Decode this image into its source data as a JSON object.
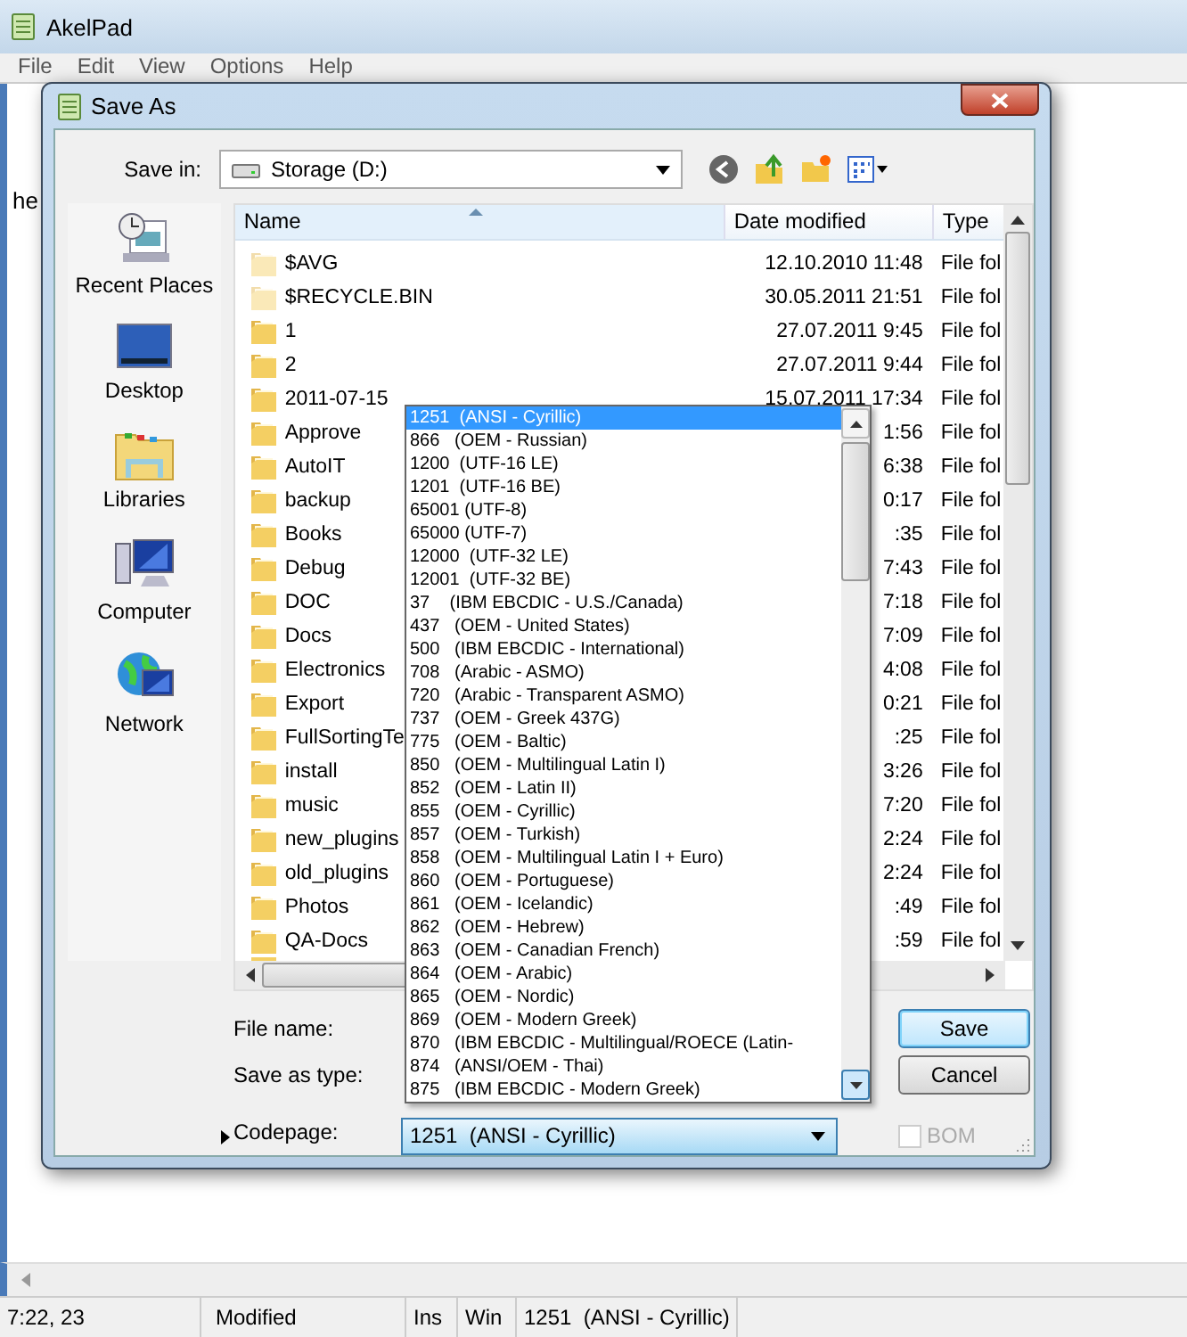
{
  "app_window": {
    "title": "AkelPad",
    "menu": [
      "File",
      "Edit",
      "View",
      "Options",
      "Help"
    ],
    "editor_text": "he"
  },
  "dialog": {
    "title": "Save As",
    "save_in": {
      "label": "Save in:",
      "value": "Storage (D:)"
    },
    "places": [
      "Recent Places",
      "Desktop",
      "Libraries",
      "Computer",
      "Network"
    ],
    "file_list": {
      "columns": [
        "Name",
        "Date modified",
        "Type"
      ],
      "rows": [
        {
          "name": "$AVG",
          "date": "12.10.2010 11:48",
          "type": "File fol",
          "hidden": true
        },
        {
          "name": "$RECYCLE.BIN",
          "date": "30.05.2011 21:51",
          "type": "File fol",
          "hidden": true
        },
        {
          "name": "1",
          "date": "27.07.2011 9:45",
          "type": "File fol",
          "hidden": false
        },
        {
          "name": "2",
          "date": "27.07.2011 9:44",
          "type": "File fol",
          "hidden": false
        },
        {
          "name": "2011-07-15",
          "date": "15.07.2011 17:34",
          "type": "File fol",
          "hidden": false
        },
        {
          "name": "Approve",
          "date": "1:56",
          "type": "File fol",
          "hidden": false
        },
        {
          "name": "AutoIT",
          "date": "6:38",
          "type": "File fol",
          "hidden": false
        },
        {
          "name": "backup",
          "date": "0:17",
          "type": "File fol",
          "hidden": false
        },
        {
          "name": "Books",
          "date": ":35",
          "type": "File fol",
          "hidden": false
        },
        {
          "name": "Debug",
          "date": "7:43",
          "type": "File fol",
          "hidden": false
        },
        {
          "name": "DOC",
          "date": "7:18",
          "type": "File fol",
          "hidden": false
        },
        {
          "name": "Docs",
          "date": "7:09",
          "type": "File fol",
          "hidden": false
        },
        {
          "name": "Electronics",
          "date": "4:08",
          "type": "File fol",
          "hidden": false
        },
        {
          "name": "Export",
          "date": "0:21",
          "type": "File fol",
          "hidden": false
        },
        {
          "name": "FullSortingTe",
          "date": ":25",
          "type": "File fol",
          "hidden": false
        },
        {
          "name": "install",
          "date": "3:26",
          "type": "File fol",
          "hidden": false
        },
        {
          "name": "music",
          "date": "7:20",
          "type": "File fol",
          "hidden": false
        },
        {
          "name": "new_plugins",
          "date": "2:24",
          "type": "File fol",
          "hidden": false
        },
        {
          "name": "old_plugins",
          "date": "2:24",
          "type": "File fol",
          "hidden": false
        },
        {
          "name": "Photos",
          "date": ":49",
          "type": "File fol",
          "hidden": false
        },
        {
          "name": "QA-Docs",
          "date": ":59",
          "type": "File fol",
          "hidden": false
        }
      ]
    },
    "fields": [
      "File name:",
      "Save as type:"
    ],
    "codepage": {
      "label": "Codepage:",
      "value": "1251  (ANSI - Cyrillic)",
      "options": [
        {
          "text": "1251  (ANSI - Cyrillic)",
          "selected": true
        },
        {
          "text": "866   (OEM - Russian)",
          "selected": false
        },
        {
          "text": "1200  (UTF-16 LE)",
          "selected": false
        },
        {
          "text": "1201  (UTF-16 BE)",
          "selected": false
        },
        {
          "text": "65001 (UTF-8)",
          "selected": false
        },
        {
          "text": "65000 (UTF-7)",
          "selected": false
        },
        {
          "text": "12000  (UTF-32 LE)",
          "selected": false
        },
        {
          "text": "12001  (UTF-32 BE)",
          "selected": false
        },
        {
          "text": "37    (IBM EBCDIC - U.S./Canada)",
          "selected": false
        },
        {
          "text": "437   (OEM - United States)",
          "selected": false
        },
        {
          "text": "500   (IBM EBCDIC - International)",
          "selected": false
        },
        {
          "text": "708   (Arabic - ASMO)",
          "selected": false
        },
        {
          "text": "720   (Arabic - Transparent ASMO)",
          "selected": false
        },
        {
          "text": "737   (OEM - Greek 437G)",
          "selected": false
        },
        {
          "text": "775   (OEM - Baltic)",
          "selected": false
        },
        {
          "text": "850   (OEM - Multilingual Latin I)",
          "selected": false
        },
        {
          "text": "852   (OEM - Latin II)",
          "selected": false
        },
        {
          "text": "855   (OEM - Cyrillic)",
          "selected": false
        },
        {
          "text": "857   (OEM - Turkish)",
          "selected": false
        },
        {
          "text": "858   (OEM - Multilingual Latin I + Euro)",
          "selected": false
        },
        {
          "text": "860   (OEM - Portuguese)",
          "selected": false
        },
        {
          "text": "861   (OEM - Icelandic)",
          "selected": false
        },
        {
          "text": "862   (OEM - Hebrew)",
          "selected": false
        },
        {
          "text": "863   (OEM - Canadian French)",
          "selected": false
        },
        {
          "text": "864   (OEM - Arabic)",
          "selected": false
        },
        {
          "text": "865   (OEM - Nordic)",
          "selected": false
        },
        {
          "text": "869   (OEM - Modern Greek)",
          "selected": false
        },
        {
          "text": "870   (IBM EBCDIC - Multilingual/ROECE (Latin-",
          "selected": false
        },
        {
          "text": "874   (ANSI/OEM - Thai)",
          "selected": false
        },
        {
          "text": "875   (IBM EBCDIC - Modern Greek)",
          "selected": false
        }
      ]
    },
    "buttons": [
      {
        "label": "Save",
        "default": true
      },
      {
        "label": "Cancel",
        "default": false
      }
    ],
    "bom": {
      "label": "BOM",
      "checked": false,
      "disabled": true
    }
  },
  "status_bar": [
    "7:22, 23",
    "Modified",
    "Ins",
    "Win",
    "1251  (ANSI - Cyrillic)"
  ]
}
